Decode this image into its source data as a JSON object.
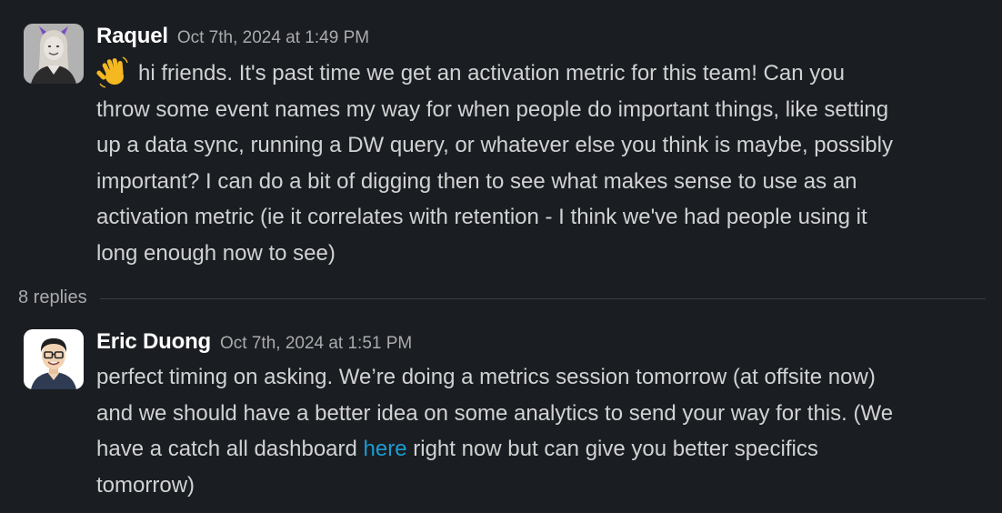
{
  "messages": [
    {
      "author": "Raquel",
      "timestamp": "Oct 7th, 2024 at 1:49 PM",
      "avatar_icon": "raquel-avatar",
      "emoji_icon": "waving-hand-emoji",
      "lines": [
        "hi friends. It's past time we get an activation metric for this team! Can you",
        "throw some event names my way for when people do important things, like setting",
        "up a data sync, running a DW query, or whatever else you think is maybe, possibly",
        "important? I can do a bit of digging then to see what makes sense to use as an",
        "activation metric (ie it correlates with retention - I think we've had people using it",
        "long enough now to see)"
      ]
    },
    {
      "author": "Eric Duong",
      "timestamp": "Oct 7th, 2024 at 1:51 PM",
      "avatar_icon": "eric-avatar",
      "lines": [
        "perfect timing on asking. We’re doing a metrics session tomorrow (at offsite now)",
        "and we should have a better idea on some analytics to send your way for this. (We"
      ],
      "line3_before": "have a catch all dashboard ",
      "line3_link": "here",
      "line3_after": " right now but can give you better specifics",
      "line4": "tomorrow)"
    }
  ],
  "thread": {
    "replies_label": "8 replies"
  },
  "colors": {
    "background": "#1a1d21",
    "text": "#d1d2d3",
    "author": "#ffffff",
    "timestamp": "#ababad",
    "link": "#1d9bd1"
  }
}
